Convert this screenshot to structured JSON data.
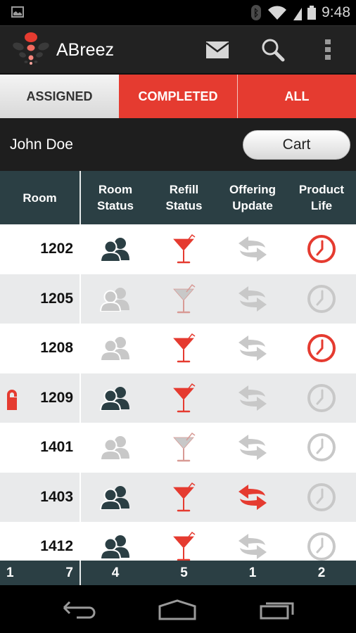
{
  "status_bar": {
    "time": "9:48",
    "icons": [
      "gallery-icon",
      "bluetooth-icon",
      "wifi-icon",
      "signal-icon",
      "battery-icon"
    ]
  },
  "action_bar": {
    "app_title": "ABreez",
    "actions": [
      {
        "icon": "mail-icon",
        "label": "Messages"
      },
      {
        "icon": "search-icon",
        "label": "Search"
      },
      {
        "icon": "overflow-menu-icon",
        "label": "More options"
      }
    ]
  },
  "tabs": [
    {
      "label": "ASSIGNED",
      "active": true
    },
    {
      "label": "COMPLETED",
      "active": false
    },
    {
      "label": "ALL",
      "active": false
    }
  ],
  "user": {
    "name": "John Doe",
    "cart_label": "Cart"
  },
  "table": {
    "headers": {
      "room": "Room",
      "room_status": "Room Status",
      "refill_status": "Refill Status",
      "offering_update": "Offering Update",
      "product_life": "Product Life"
    },
    "rows": [
      {
        "room": "1202",
        "dnd": false,
        "room_status": "occupied",
        "refill": "needed",
        "offering": "none",
        "product_life": "expired"
      },
      {
        "room": "1205",
        "dnd": false,
        "room_status": "vacant",
        "refill": "ok",
        "offering": "none",
        "product_life": "ok"
      },
      {
        "room": "1208",
        "dnd": false,
        "room_status": "vacant",
        "refill": "needed",
        "offering": "none",
        "product_life": "expired"
      },
      {
        "room": "1209",
        "dnd": true,
        "room_status": "occupied",
        "refill": "needed",
        "offering": "none",
        "product_life": "ok"
      },
      {
        "room": "1401",
        "dnd": false,
        "room_status": "vacant",
        "refill": "ok",
        "offering": "none",
        "product_life": "ok"
      },
      {
        "room": "1403",
        "dnd": false,
        "room_status": "occupied",
        "refill": "needed",
        "offering": "update",
        "product_life": "ok"
      },
      {
        "room": "1412",
        "dnd": false,
        "room_status": "occupied",
        "refill": "needed",
        "offering": "none",
        "product_life": "ok"
      }
    ],
    "footer": {
      "room_left": "1",
      "room_right": "7",
      "room_status": "4",
      "refill_status": "5",
      "offering_update": "1",
      "product_life": "2"
    }
  },
  "nav_bar": {
    "buttons": [
      "back-icon",
      "home-icon",
      "recents-icon"
    ]
  },
  "colors": {
    "accent_red": "#e53b30",
    "header_teal": "#2b3f44",
    "active_icon": "#2b3f44",
    "inactive_icon": "#c8c8c8",
    "row_alt": "#e9eaeb"
  }
}
